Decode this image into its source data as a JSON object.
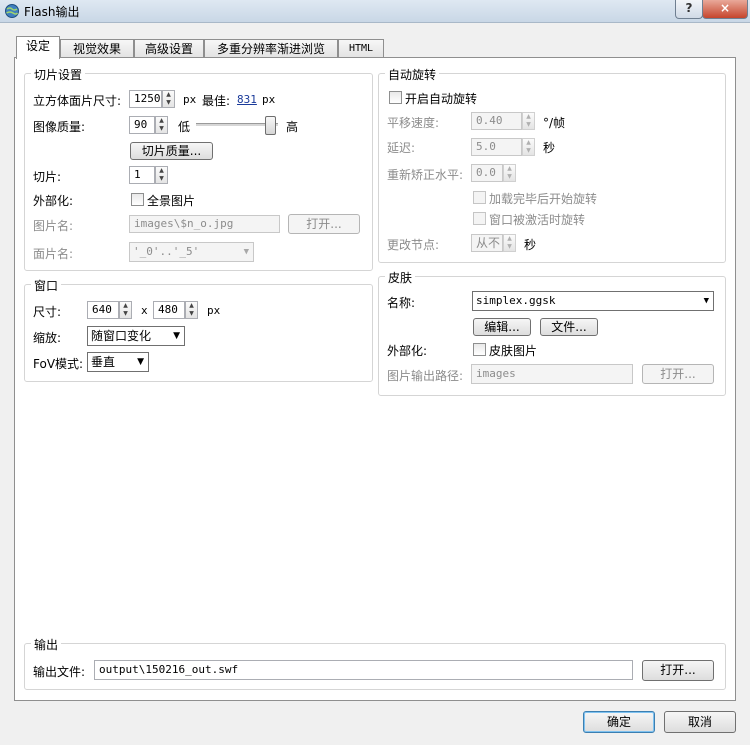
{
  "window": {
    "title": "Flash输出",
    "help": "?",
    "close": "×"
  },
  "tabs": [
    "设定",
    "视觉效果",
    "高级设置",
    "多重分辨率渐进浏览",
    "HTML"
  ],
  "tiles": {
    "title": "切片设置",
    "cube_size_label": "立方体面片尺寸:",
    "cube_size_value": "1250",
    "px": "px",
    "best_label": "最佳:",
    "best_value": "831",
    "best_unit": "px",
    "quality_label": "图像质量:",
    "quality_value": "90",
    "quality_low": "低",
    "quality_high": "高",
    "quality_level": 0.9,
    "tile_quality_button": "切片质量...",
    "tiles_label": "切片:",
    "tiles_value": "1",
    "externalize_label": "外部化:",
    "panorama_image_label": "全景图片",
    "image_name_label": "图片名:",
    "image_name_value": "images\\$n_o.jpg",
    "open_button": "打开...",
    "face_name_label": "面片名:",
    "face_name_value": "'_0'..'_5'"
  },
  "window_group": {
    "title": "窗口",
    "size_label": "尺寸:",
    "width": "640",
    "x": "x",
    "height": "480",
    "px": "px",
    "scale_label": "缩放:",
    "scale_value": "随窗口变化",
    "fov_label": "FoV模式:",
    "fov_value": "垂直"
  },
  "autorotate": {
    "title": "自动旋转",
    "enable_label": "开启自动旋转",
    "pan_speed_label": "平移速度:",
    "pan_speed_value": "0.40",
    "pan_speed_unit": "°/帧",
    "delay_label": "延迟:",
    "delay_value": "5.0",
    "delay_unit": "秒",
    "level_label": "重新矫正水平:",
    "level_value": "0.0",
    "start_after_load": "加载完毕后开始旋转",
    "rotate_when_active": "窗口被激活时旋转",
    "change_node_label": "更改节点:",
    "change_node_value": "从不",
    "change_node_unit": "秒"
  },
  "skin": {
    "title": "皮肤",
    "name_label": "名称:",
    "name_value": "simplex.ggsk",
    "edit_button": "编辑...",
    "file_button": "文件...",
    "externalize_label": "外部化:",
    "skin_images_label": "皮肤图片",
    "output_path_label": "图片输出路径:",
    "output_path_value": "images",
    "open_button": "打开..."
  },
  "output": {
    "title": "输出",
    "file_label": "输出文件:",
    "file_value": "output\\150216_out.swf",
    "open_button": "打开..."
  },
  "footer": {
    "ok": "确定",
    "cancel": "取消"
  }
}
